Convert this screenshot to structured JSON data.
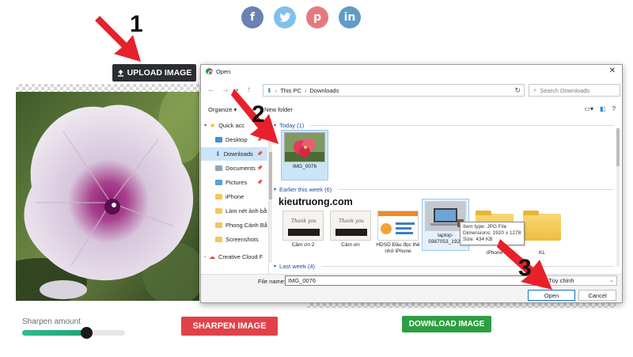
{
  "social": [
    {
      "name": "facebook",
      "glyph": "f",
      "icon": "facebook-icon"
    },
    {
      "name": "twitter",
      "glyph": "t",
      "icon": "twitter-icon"
    },
    {
      "name": "pinterest",
      "glyph": "p",
      "icon": "pinterest-icon"
    },
    {
      "name": "linkedin",
      "glyph": "in",
      "icon": "linkedin-icon"
    }
  ],
  "upload_button": {
    "label": "UPLOAD IMAGE",
    "icon": "upload-icon"
  },
  "sharpen": {
    "label": "Sharpen amount",
    "level": 0.62,
    "button_label": "SHARPEN IMAGE"
  },
  "download_button": {
    "label": "DOWNLOAD IMAGE"
  },
  "dialog": {
    "title": "Open",
    "path": [
      "This PC",
      "Downloads"
    ],
    "search_placeholder": "Search Downloads",
    "organize_label": "Organize ▾",
    "new_folder_label": "New folder",
    "sidebar": [
      {
        "label": "Quick access",
        "display": "Quick acc",
        "icon": "star-icon"
      },
      {
        "label": "Desktop",
        "icon": "folder-icon"
      },
      {
        "label": "Downloads",
        "icon": "download-icon"
      },
      {
        "label": "Documents",
        "icon": "folder-icon"
      },
      {
        "label": "Pictures",
        "icon": "folder-icon"
      },
      {
        "label": "iPhone",
        "icon": "folder-icon"
      },
      {
        "label": "Làm nét ảnh bằ",
        "icon": "folder-icon"
      },
      {
        "label": "Phong Cảnh Bắ",
        "icon": "folder-icon"
      },
      {
        "label": "Screenshots",
        "icon": "folder-icon"
      },
      {
        "label": "Creative Cloud F",
        "icon": "cloud-icon"
      }
    ],
    "groups": [
      {
        "label": "Today (1)"
      },
      {
        "label": "Earlier this week (6)"
      },
      {
        "label": "Last week (4)"
      }
    ],
    "today_files": [
      {
        "name": "IMG_0076"
      }
    ],
    "earlier_files": [
      {
        "name": "Cảm ơn 2"
      },
      {
        "name": "Cảm ơn"
      },
      {
        "name": "HDSD Đầu đọc thẻ nhớ iPhone"
      },
      {
        "name": "laptop-5987053_1920"
      },
      {
        "name": "iPhone"
      },
      {
        "name": "KL"
      }
    ],
    "tooltip": [
      "Item type: JPG File",
      "Dimensions: 1920 x 1278",
      "Size: 434 KB"
    ],
    "file_name_label": "File name:",
    "file_name_value": "IMG_0076",
    "filter_value": "Tùy chỉnh",
    "open_label": "Open",
    "cancel_label": "Cancel"
  },
  "watermark": "kieutruong.com",
  "steps": [
    "1",
    "2",
    "3"
  ],
  "colors": {
    "arrow": "#e8202b",
    "sharpen": "#e0424a",
    "download": "#2e9e42",
    "slider": "#1ea277"
  }
}
